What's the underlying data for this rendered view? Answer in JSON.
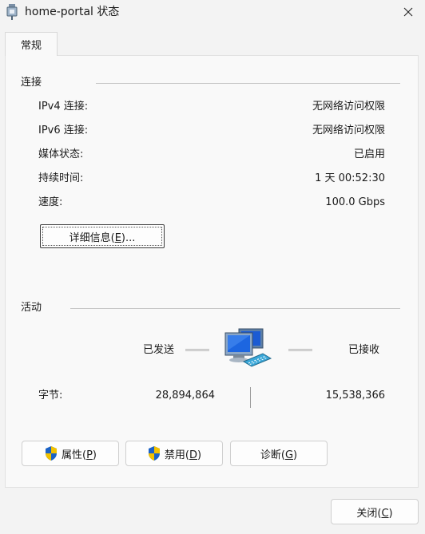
{
  "window": {
    "title": "home-portal 状态",
    "icon": "network-adapter-icon"
  },
  "tabs": [
    {
      "label": "常规",
      "selected": true
    }
  ],
  "connection": {
    "section_label": "连接",
    "rows": [
      {
        "label": "IPv4 连接:",
        "value": "无网络访问权限"
      },
      {
        "label": "IPv6 连接:",
        "value": "无网络访问权限"
      },
      {
        "label": "媒体状态:",
        "value": "已启用"
      },
      {
        "label": "持续时间:",
        "value": "1 天 00:52:30"
      },
      {
        "label": "速度:",
        "value": "100.0 Gbps"
      }
    ],
    "details_button": {
      "text": "详细信息(",
      "key": "E",
      "suffix": ")..."
    }
  },
  "activity": {
    "section_label": "活动",
    "sent_label": "已发送",
    "received_label": "已接收",
    "bytes_label": "字节:",
    "bytes_sent": "28,894,864",
    "bytes_received": "15,538,366"
  },
  "buttons": {
    "properties": {
      "text": "属性(",
      "key": "P",
      "suffix": ")"
    },
    "disable": {
      "text": "禁用(",
      "key": "D",
      "suffix": ")"
    },
    "diagnose": {
      "text": "诊断(",
      "key": "G",
      "suffix": ")"
    },
    "close": {
      "text": "关闭(",
      "key": "C",
      "suffix": ")"
    }
  },
  "colors": {
    "background": "#f3f3f3",
    "panel": "#f9f9f9",
    "shield_blue": "#1c63c6",
    "shield_yellow": "#f2c200"
  }
}
